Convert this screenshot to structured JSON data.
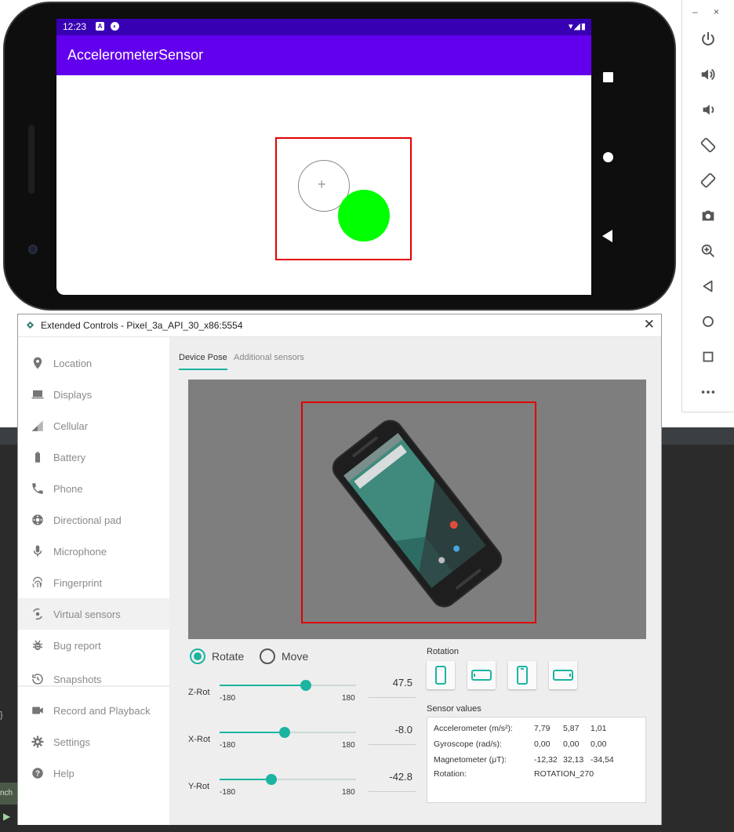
{
  "device": {
    "status_time": "12:23",
    "app_title": "AccelerometerSensor"
  },
  "emulator_toolbar": {
    "minimize": "–",
    "close": "×",
    "buttons": [
      "power-icon",
      "volume-up-icon",
      "volume-down-icon",
      "rotate-left-icon",
      "rotate-right-icon",
      "camera-icon",
      "zoom-icon",
      "back-icon",
      "home-icon",
      "overview-icon",
      "more-icon"
    ]
  },
  "extended_controls": {
    "title": "Extended Controls - Pixel_3a_API_30_x86:5554",
    "close": "✕",
    "sidebar": [
      {
        "label": "Location",
        "icon": "location-pin-icon"
      },
      {
        "label": "Displays",
        "icon": "display-icon"
      },
      {
        "label": "Cellular",
        "icon": "cellular-signal-icon"
      },
      {
        "label": "Battery",
        "icon": "battery-icon"
      },
      {
        "label": "Phone",
        "icon": "phone-icon"
      },
      {
        "label": "Directional pad",
        "icon": "dpad-icon"
      },
      {
        "label": "Microphone",
        "icon": "microphone-icon"
      },
      {
        "label": "Fingerprint",
        "icon": "fingerprint-icon"
      },
      {
        "label": "Virtual sensors",
        "icon": "sensors-icon"
      },
      {
        "label": "Bug report",
        "icon": "bug-icon"
      },
      {
        "label": "Snapshots",
        "icon": "history-icon"
      },
      {
        "label": "Record and Playback",
        "icon": "video-camera-icon"
      },
      {
        "label": "Settings",
        "icon": "gear-icon"
      },
      {
        "label": "Help",
        "icon": "help-icon"
      }
    ],
    "active_item": "Virtual sensors",
    "tabs": [
      {
        "label": "Device Pose",
        "active": true
      },
      {
        "label": "Additional sensors",
        "active": false
      }
    ],
    "mode": {
      "rotate_label": "Rotate",
      "move_label": "Move",
      "selected": "Rotate"
    },
    "sliders": [
      {
        "name": "Z-Rot",
        "min_label": "-180",
        "max_label": "180",
        "value": 47.5,
        "value_text": "47.5"
      },
      {
        "name": "X-Rot",
        "min_label": "-180",
        "max_label": "180",
        "value": -8.0,
        "value_text": "-8.0"
      },
      {
        "name": "Y-Rot",
        "min_label": "-180",
        "max_label": "180",
        "value": -42.8,
        "value_text": "-42.8"
      }
    ],
    "rotation_title": "Rotation",
    "rotation_buttons": [
      "portrait-icon",
      "landscape-icon",
      "reverse-portrait-icon",
      "reverse-landscape-icon"
    ],
    "sensor_values_title": "Sensor values",
    "sensor_values": [
      {
        "label": "Accelerometer (m/s²):",
        "v1": "7,79",
        "v2": "5,87",
        "v3": "1,01"
      },
      {
        "label": "Gyroscope (rad/s):",
        "v1": "0,00",
        "v2": "0,00",
        "v3": "0,00"
      },
      {
        "label": "Magnetometer (μT):",
        "v1": "-12,32",
        "v2": "32,13",
        "v3": "-34,54"
      },
      {
        "label": "Rotation:",
        "v1": "ROTATION_270",
        "v2": "",
        "v3": ""
      }
    ],
    "accent_color": "#1bb4a0"
  },
  "ide": {
    "tab_text": "nch",
    "brace": "}"
  }
}
